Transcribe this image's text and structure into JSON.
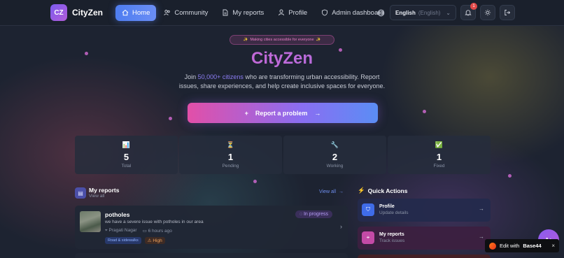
{
  "header": {
    "logo_text": "CZ",
    "brand": "CityZen",
    "nav": [
      {
        "label": "Home",
        "icon": "home-icon",
        "active": true
      },
      {
        "label": "Community",
        "icon": "users-icon",
        "active": false
      },
      {
        "label": "My reports",
        "icon": "document-icon",
        "active": false
      },
      {
        "label": "Profile",
        "icon": "user-icon",
        "active": false
      },
      {
        "label": "Admin dashboard",
        "icon": "shield-icon",
        "active": false
      }
    ],
    "language": {
      "main": "English",
      "sub": "(English)"
    },
    "notification_count": "1"
  },
  "hero": {
    "pill": "Making cities accessible for everyone",
    "title": "CityZen",
    "text_before": "Join ",
    "text_highlight": "50,000+ citizens",
    "text_after": " who are transforming urban accessibility. Report issues, share experiences, and help create inclusive spaces for everyone.",
    "cta": "Report a problem"
  },
  "stats": [
    {
      "icon": "📊",
      "value": "5",
      "label": "Total"
    },
    {
      "icon": "⏳",
      "value": "1",
      "label": "Pending"
    },
    {
      "icon": "🔧",
      "value": "2",
      "label": "Working"
    },
    {
      "icon": "✅",
      "value": "1",
      "label": "Fixed"
    }
  ],
  "my_reports": {
    "title": "My reports",
    "subtitle": "View all",
    "view_all": "View all",
    "items": [
      {
        "title": "potholes",
        "description": "we have a severe issue with potholes in our area",
        "location": "Pragati Nagar",
        "time": "6 hours ago",
        "category": "Road & sidewalks",
        "priority": "High",
        "status": "In progress"
      }
    ]
  },
  "quick_actions": {
    "title": "Quick Actions",
    "items": [
      {
        "title": "Profile",
        "subtitle": "Update details"
      },
      {
        "title": "My reports",
        "subtitle": "Track issues"
      }
    ]
  },
  "fab": {
    "label": "A+"
  },
  "edit_badge": {
    "prefix": "Edit with",
    "brand": "Base44",
    "close": "×"
  },
  "colors": {
    "accent": "#4e7df0",
    "brand_pink": "#e05cc4",
    "brand_purple": "#9b78ee"
  }
}
